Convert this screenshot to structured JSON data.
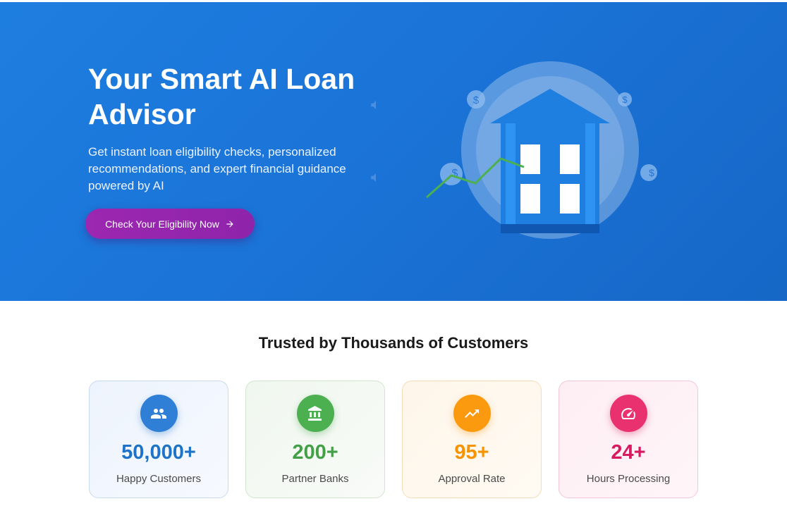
{
  "hero": {
    "title": "Your Smart AI Loan Advisor",
    "subtitle": "Get instant loan eligibility checks, personalized recommendations, and expert financial guidance powered by AI",
    "cta_label": "Check Your Eligibility Now",
    "cta_icon": "arrow-right-icon",
    "illustration_icon": "bank-building-icon",
    "coin_symbol": "$"
  },
  "colors": {
    "hero_bg": "#1e7ee0",
    "cta": "#9c27b0",
    "blue": "#1e73c8",
    "green": "#43a047",
    "orange": "#f59300",
    "pink": "#d81b60"
  },
  "stats": {
    "title": "Trusted by Thousands of Customers",
    "items": [
      {
        "value": "50,000+",
        "label": "Happy Customers",
        "icon": "people-icon",
        "color": "#1e73c8"
      },
      {
        "value": "200+",
        "label": "Partner Banks",
        "icon": "bank-icon",
        "color": "#43a047"
      },
      {
        "value": "95+",
        "label": "Approval Rate",
        "icon": "trending-up-icon",
        "color": "#f59300"
      },
      {
        "value": "24+",
        "label": "Hours Processing",
        "icon": "speedometer-icon",
        "color": "#d81b60"
      }
    ]
  }
}
